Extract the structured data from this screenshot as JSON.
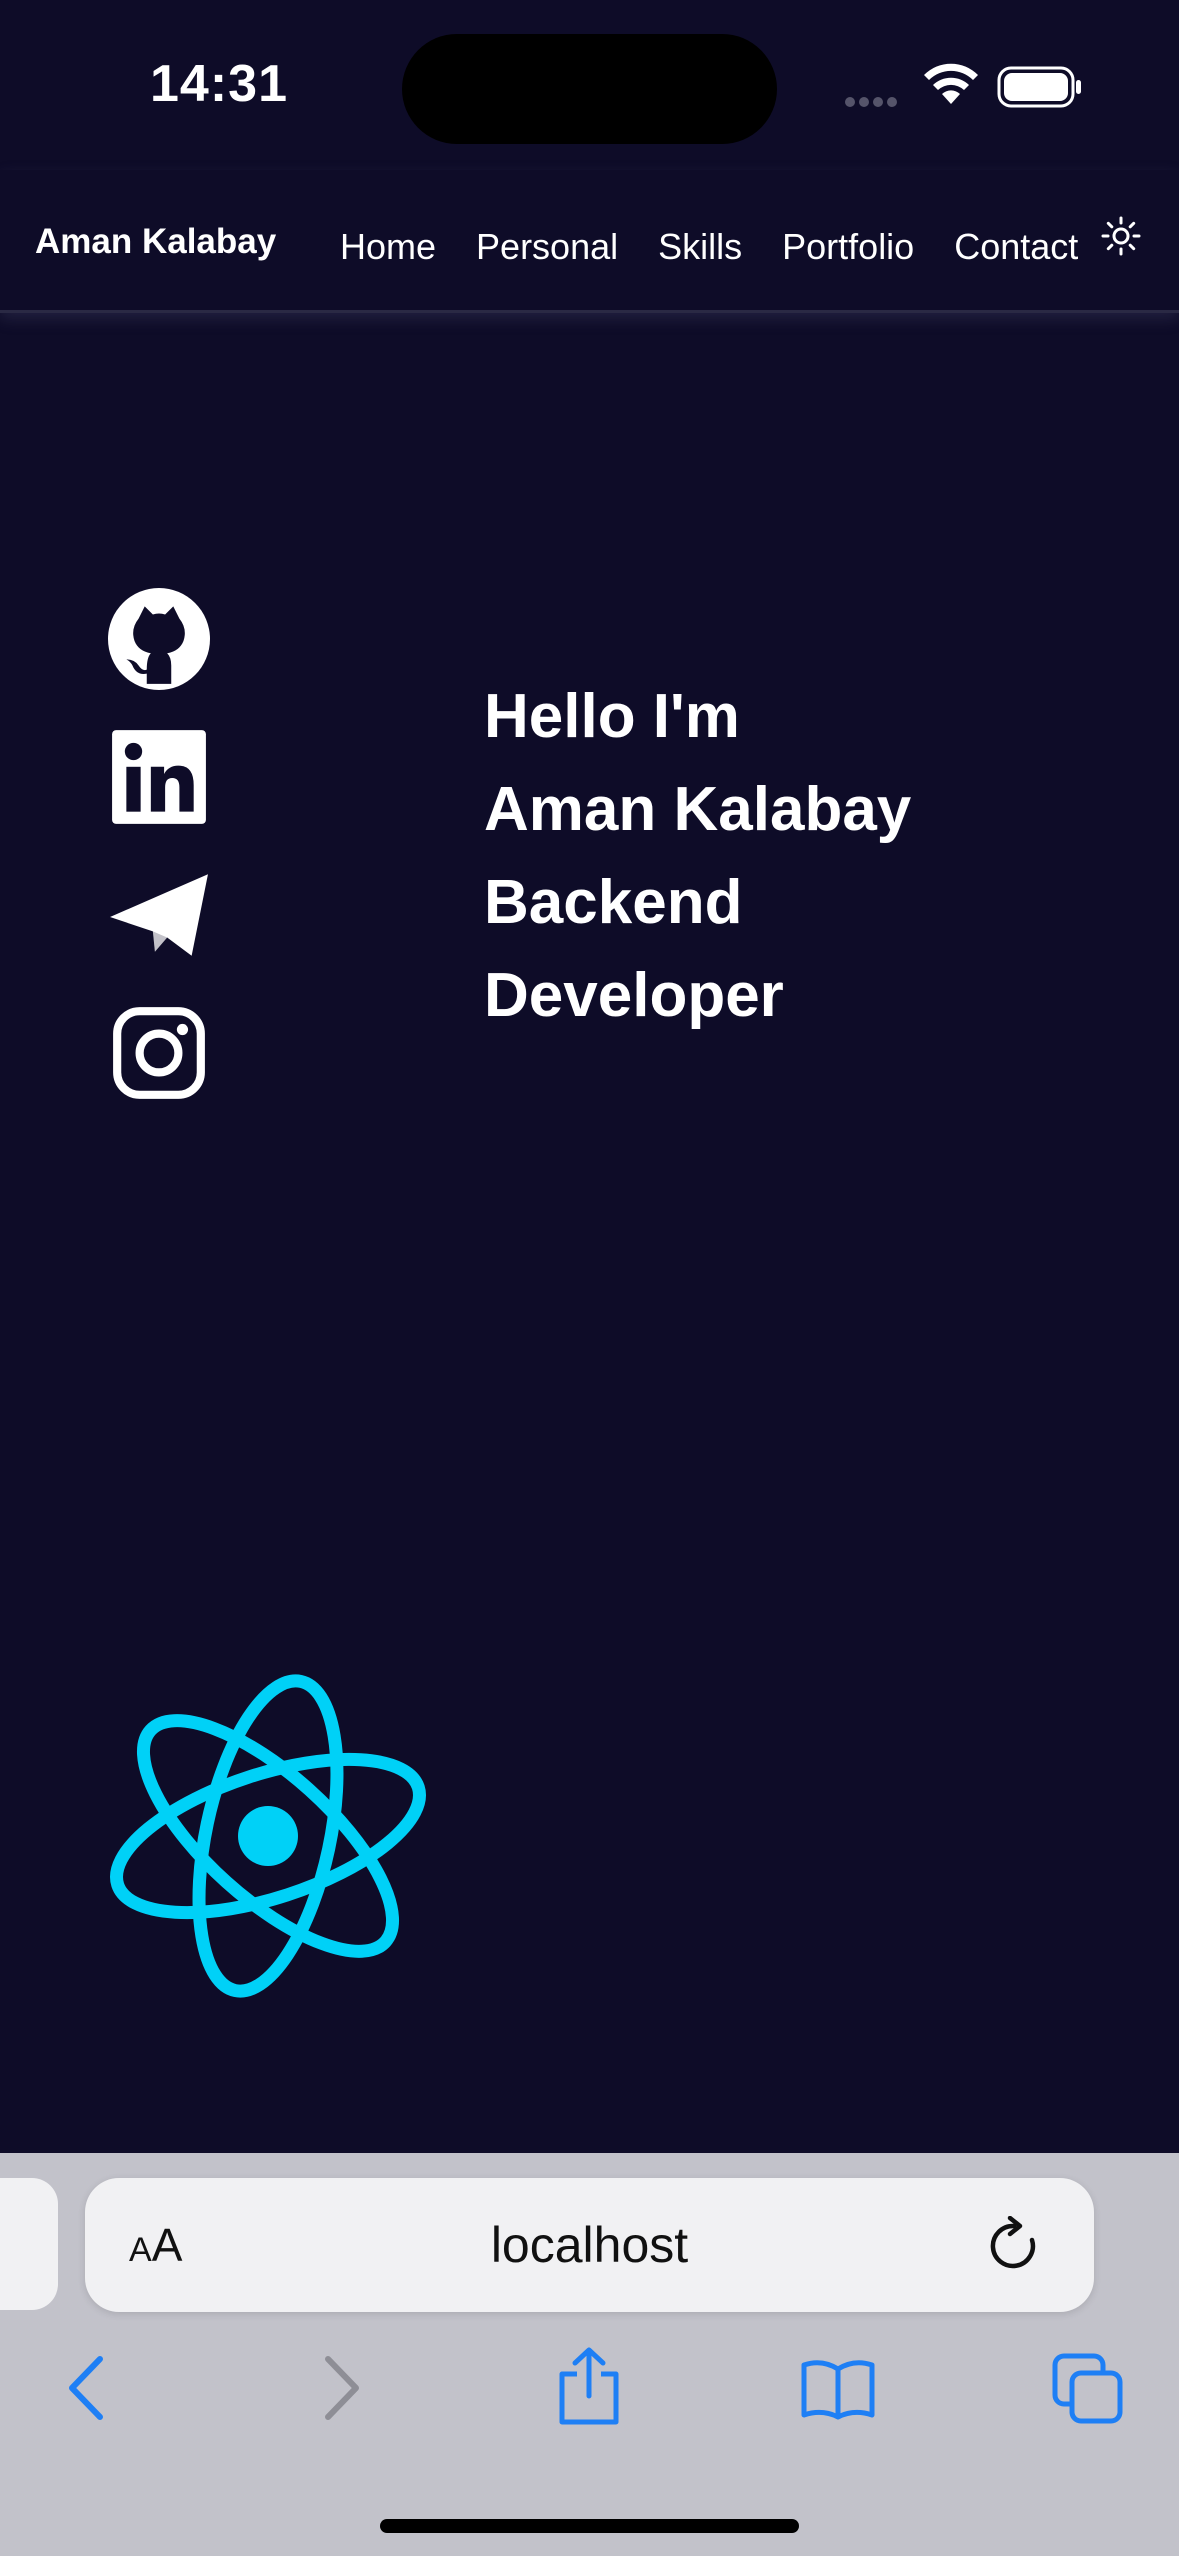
{
  "status_bar": {
    "time": "14:31"
  },
  "navbar": {
    "brand": "Aman Kalabay",
    "links": [
      "Home",
      "Personal",
      "Skills",
      "Portfolio",
      "Contact"
    ],
    "theme_toggle_icon": "sun-icon"
  },
  "socials": [
    {
      "icon": "github-icon"
    },
    {
      "icon": "linkedin-icon"
    },
    {
      "icon": "telegram-icon"
    },
    {
      "icon": "instagram-icon"
    }
  ],
  "hero": {
    "line1": "Hello I'm",
    "line2": "Aman Kalabay",
    "line3": "Backend",
    "line4": "Developer"
  },
  "decorations": {
    "logo_icon": "react-atom-icon",
    "logo_color": "#00d1f7"
  },
  "browser": {
    "aa_small": "A",
    "aa_large": "A",
    "url": "localhost",
    "accent_color": "#1e7ff5",
    "toolbar_icons": [
      "back-icon",
      "forward-icon",
      "share-icon",
      "bookmarks-icon",
      "tabs-icon"
    ]
  },
  "colors": {
    "background": "#0e0c28",
    "text": "#ffffff",
    "browser_chrome": "#c2c2ca"
  }
}
